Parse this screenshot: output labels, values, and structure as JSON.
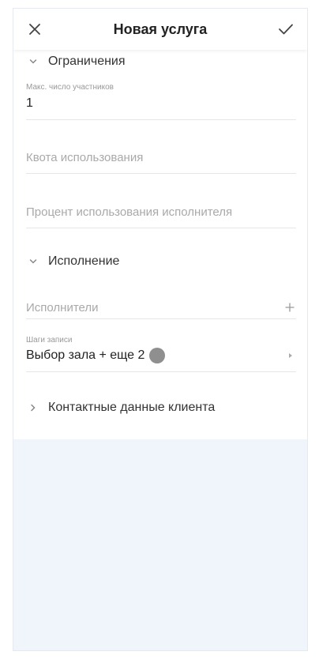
{
  "header": {
    "title": "Новая услуга"
  },
  "sections": {
    "limits": {
      "title": "Ограничения",
      "max_participants": {
        "label": "Макс. число участников",
        "value": "1"
      },
      "usage_quota": {
        "placeholder": "Квота использования"
      },
      "executor_usage_percent": {
        "placeholder": "Процент использования исполнителя"
      }
    },
    "execution": {
      "title": "Исполнение",
      "executors": {
        "placeholder": "Исполнители"
      },
      "booking_steps": {
        "label": "Шаги записи",
        "value": "Выбор зала + еще 2"
      }
    },
    "client_contacts": {
      "title": "Контактные данные клиента"
    }
  },
  "icons": {
    "close": "close-icon",
    "confirm": "check-icon",
    "expanded": "chevron-down-icon",
    "collapsed": "chevron-right-icon",
    "add": "plus-icon",
    "open": "triangle-right-icon"
  },
  "colors": {
    "background": "#f0f4fb",
    "panel": "#ffffff",
    "text": "#222222",
    "placeholder": "#a9a9a9",
    "badge": "#8f8f8f"
  }
}
